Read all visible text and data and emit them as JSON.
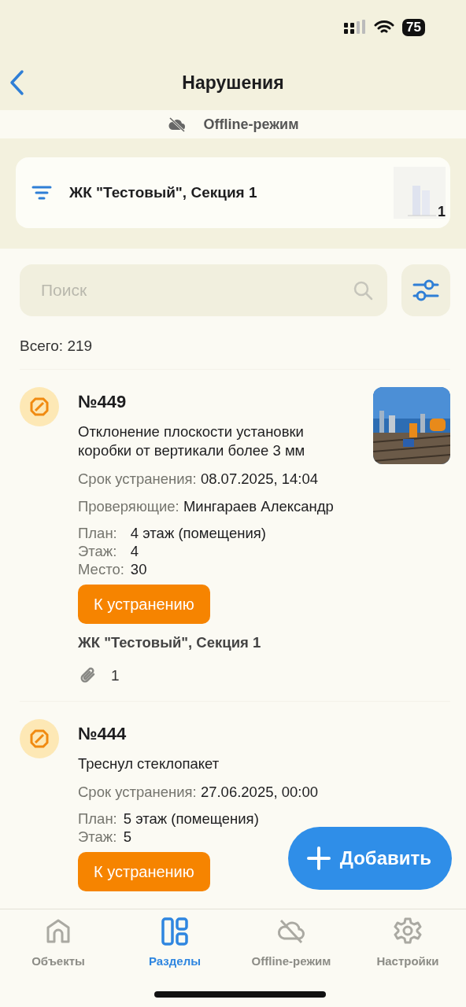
{
  "status_bar": {
    "battery": "75"
  },
  "header": {
    "title": "Нарушения"
  },
  "offline_banner": {
    "label": "Offline-режим"
  },
  "object_selector": {
    "label": "ЖК \"Тестовый\", Секция 1",
    "thumbnail_badge": "1"
  },
  "search": {
    "placeholder": "Поиск"
  },
  "total": "Всего: 219",
  "items": [
    {
      "number": "№449",
      "description": "Отклонение плоскости установки коробки от вертикали более 3 мм",
      "has_photo": true,
      "meta": [
        {
          "label": "Срок устранения:",
          "value": "08.07.2025, 14:04"
        },
        {
          "label": "Проверяющие:",
          "value": "Мингараев Александр"
        }
      ],
      "location": [
        {
          "label": "План:",
          "value": "4 этаж (помещения)"
        },
        {
          "label": "Этаж:",
          "value": "4"
        },
        {
          "label": "Место:",
          "value": "30"
        }
      ],
      "status": "К устранению",
      "object": "ЖК \"Тестовый\", Секция 1",
      "attachments": "1"
    },
    {
      "number": "№444",
      "description": "Треснул стеклопакет",
      "has_photo": false,
      "meta": [
        {
          "label": "Срок устранения:",
          "value": "27.06.2025, 00:00"
        }
      ],
      "location": [
        {
          "label": "План:",
          "value": "5 этаж (помещения)"
        },
        {
          "label": "Этаж:",
          "value": "5"
        }
      ],
      "status": "К устранению"
    }
  ],
  "add_button": {
    "label": "Добавить"
  },
  "tabs": [
    {
      "kind": "home",
      "label": "Объекты",
      "selected": false
    },
    {
      "kind": "sections",
      "label": "Разделы",
      "selected": true
    },
    {
      "kind": "offline",
      "label": "Offline-режим",
      "selected": false
    },
    {
      "kind": "settings",
      "label": "Настройки",
      "selected": false
    }
  ]
}
